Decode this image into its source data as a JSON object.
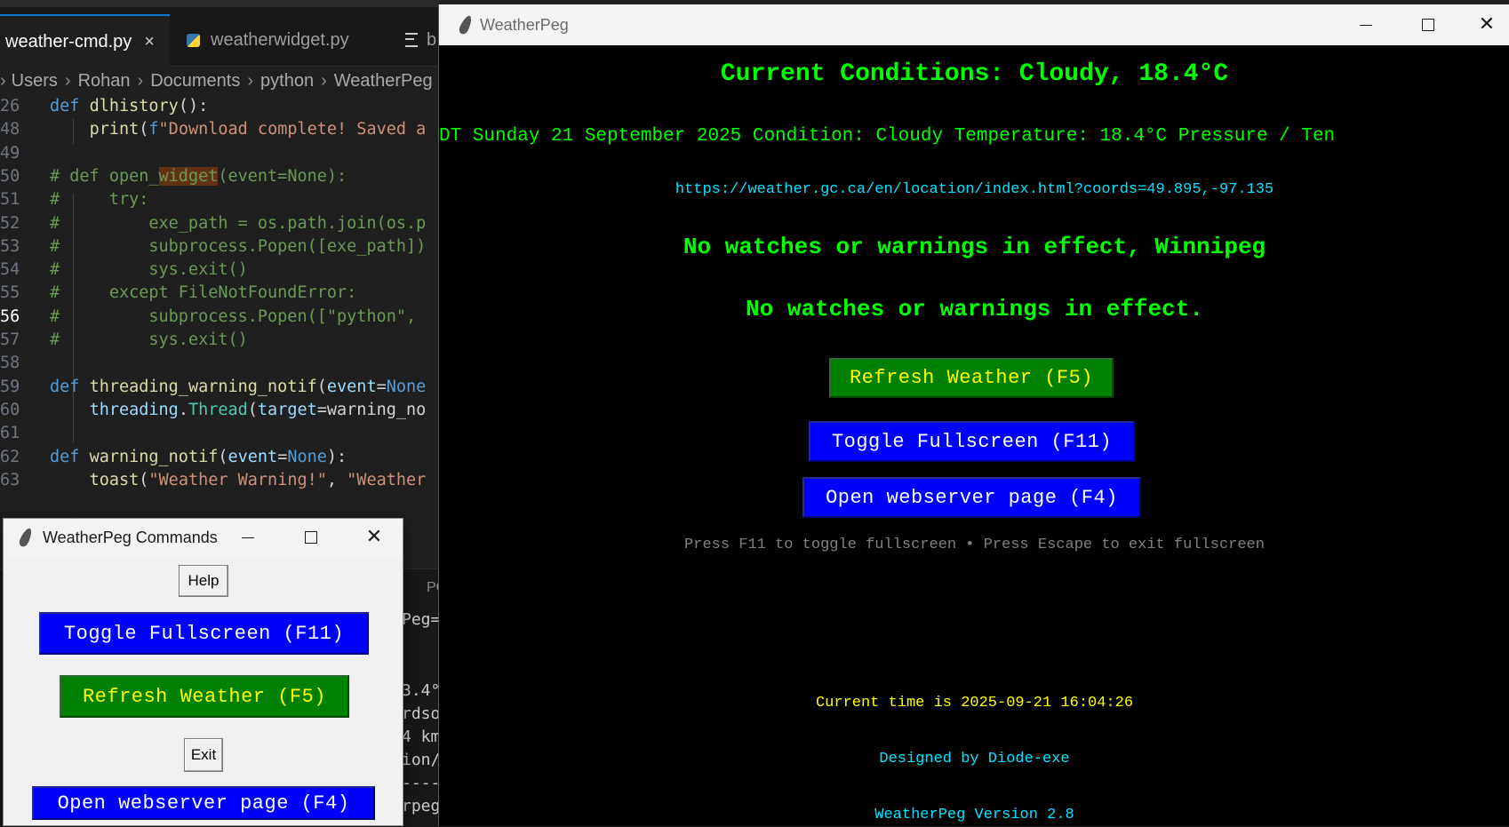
{
  "editor": {
    "tabs": [
      {
        "label": "weather-cmd.py",
        "close": "×"
      },
      {
        "label": "weatherwidget.py"
      },
      {
        "label": "b"
      }
    ],
    "breadcrumb": [
      "Users",
      "Rohan",
      "Documents",
      "python",
      "WeatherPeg"
    ],
    "code_lines": [
      {
        "n": "26",
        "text": "def dlhistory():"
      },
      {
        "n": "48",
        "text": "    print(f\"Download complete! Saved a"
      },
      {
        "n": "49",
        "text": ""
      },
      {
        "n": "50",
        "text": "# def open_widget(event=None):"
      },
      {
        "n": "51",
        "text": "#     try:"
      },
      {
        "n": "52",
        "text": "#         exe_path = os.path.join(os.p"
      },
      {
        "n": "53",
        "text": "#         subprocess.Popen([exe_path])"
      },
      {
        "n": "54",
        "text": "#         sys.exit()"
      },
      {
        "n": "55",
        "text": "#     except FileNotFoundError:"
      },
      {
        "n": "56",
        "text": "#         subprocess.Popen([\"python\","
      },
      {
        "n": "57",
        "text": "#         sys.exit()"
      },
      {
        "n": "58",
        "text": ""
      },
      {
        "n": "59",
        "text": "def threading_warning_notif(event=None"
      },
      {
        "n": "60",
        "text": "    threading.Thread(target=warning_no"
      },
      {
        "n": "61",
        "text": ""
      },
      {
        "n": "62",
        "text": "def warning_notif(event=None):"
      },
      {
        "n": "63",
        "text": "    toast(\"Weather Warning!\", \"Weather"
      }
    ],
    "terminal_fragments": [
      "Peg=",
      "3.4°",
      "rdso",
      "4 km",
      "ion/",
      "----",
      "rpeg"
    ],
    "panel_tab": "PO"
  },
  "commands_window": {
    "title": "WeatherPeg Commands",
    "help_label": "Help",
    "toggle_label": "Toggle Fullscreen (F11)",
    "refresh_label": "Refresh Weather (F5)",
    "exit_label": "Exit",
    "webserver_label": "Open webserver page (F4)"
  },
  "weatherpeg_window": {
    "title": "WeatherPeg",
    "current_conditions": "Current Conditions: Cloudy, 18.4°C",
    "observation": "DT Sunday 21 September 2025 Condition: Cloudy Temperature: 18.4°C Pressure / Ten",
    "url": "https://weather.gc.ca/en/location/index.html?coords=49.895,-97.135",
    "warning_city": "No watches or warnings in effect, Winnipeg",
    "warning_general": "No watches or warnings in effect.",
    "refresh_label": "Refresh Weather (F5)",
    "toggle_label": "Toggle Fullscreen (F11)",
    "webserver_label": "Open webserver page (F4)",
    "hint": "Press F11 to toggle fullscreen • Press Escape to exit fullscreen",
    "current_time": "Current time is 2025-09-21 16:04:26",
    "designed_by": "Designed by Diode-exe",
    "version": "WeatherPeg Version 2.8"
  },
  "colors": {
    "bright_green": "#00ff00",
    "cyan": "#00e5ff",
    "yellow": "#ffff00",
    "grey": "#808080",
    "button_blue": "#0000ff",
    "button_green": "#008000"
  }
}
